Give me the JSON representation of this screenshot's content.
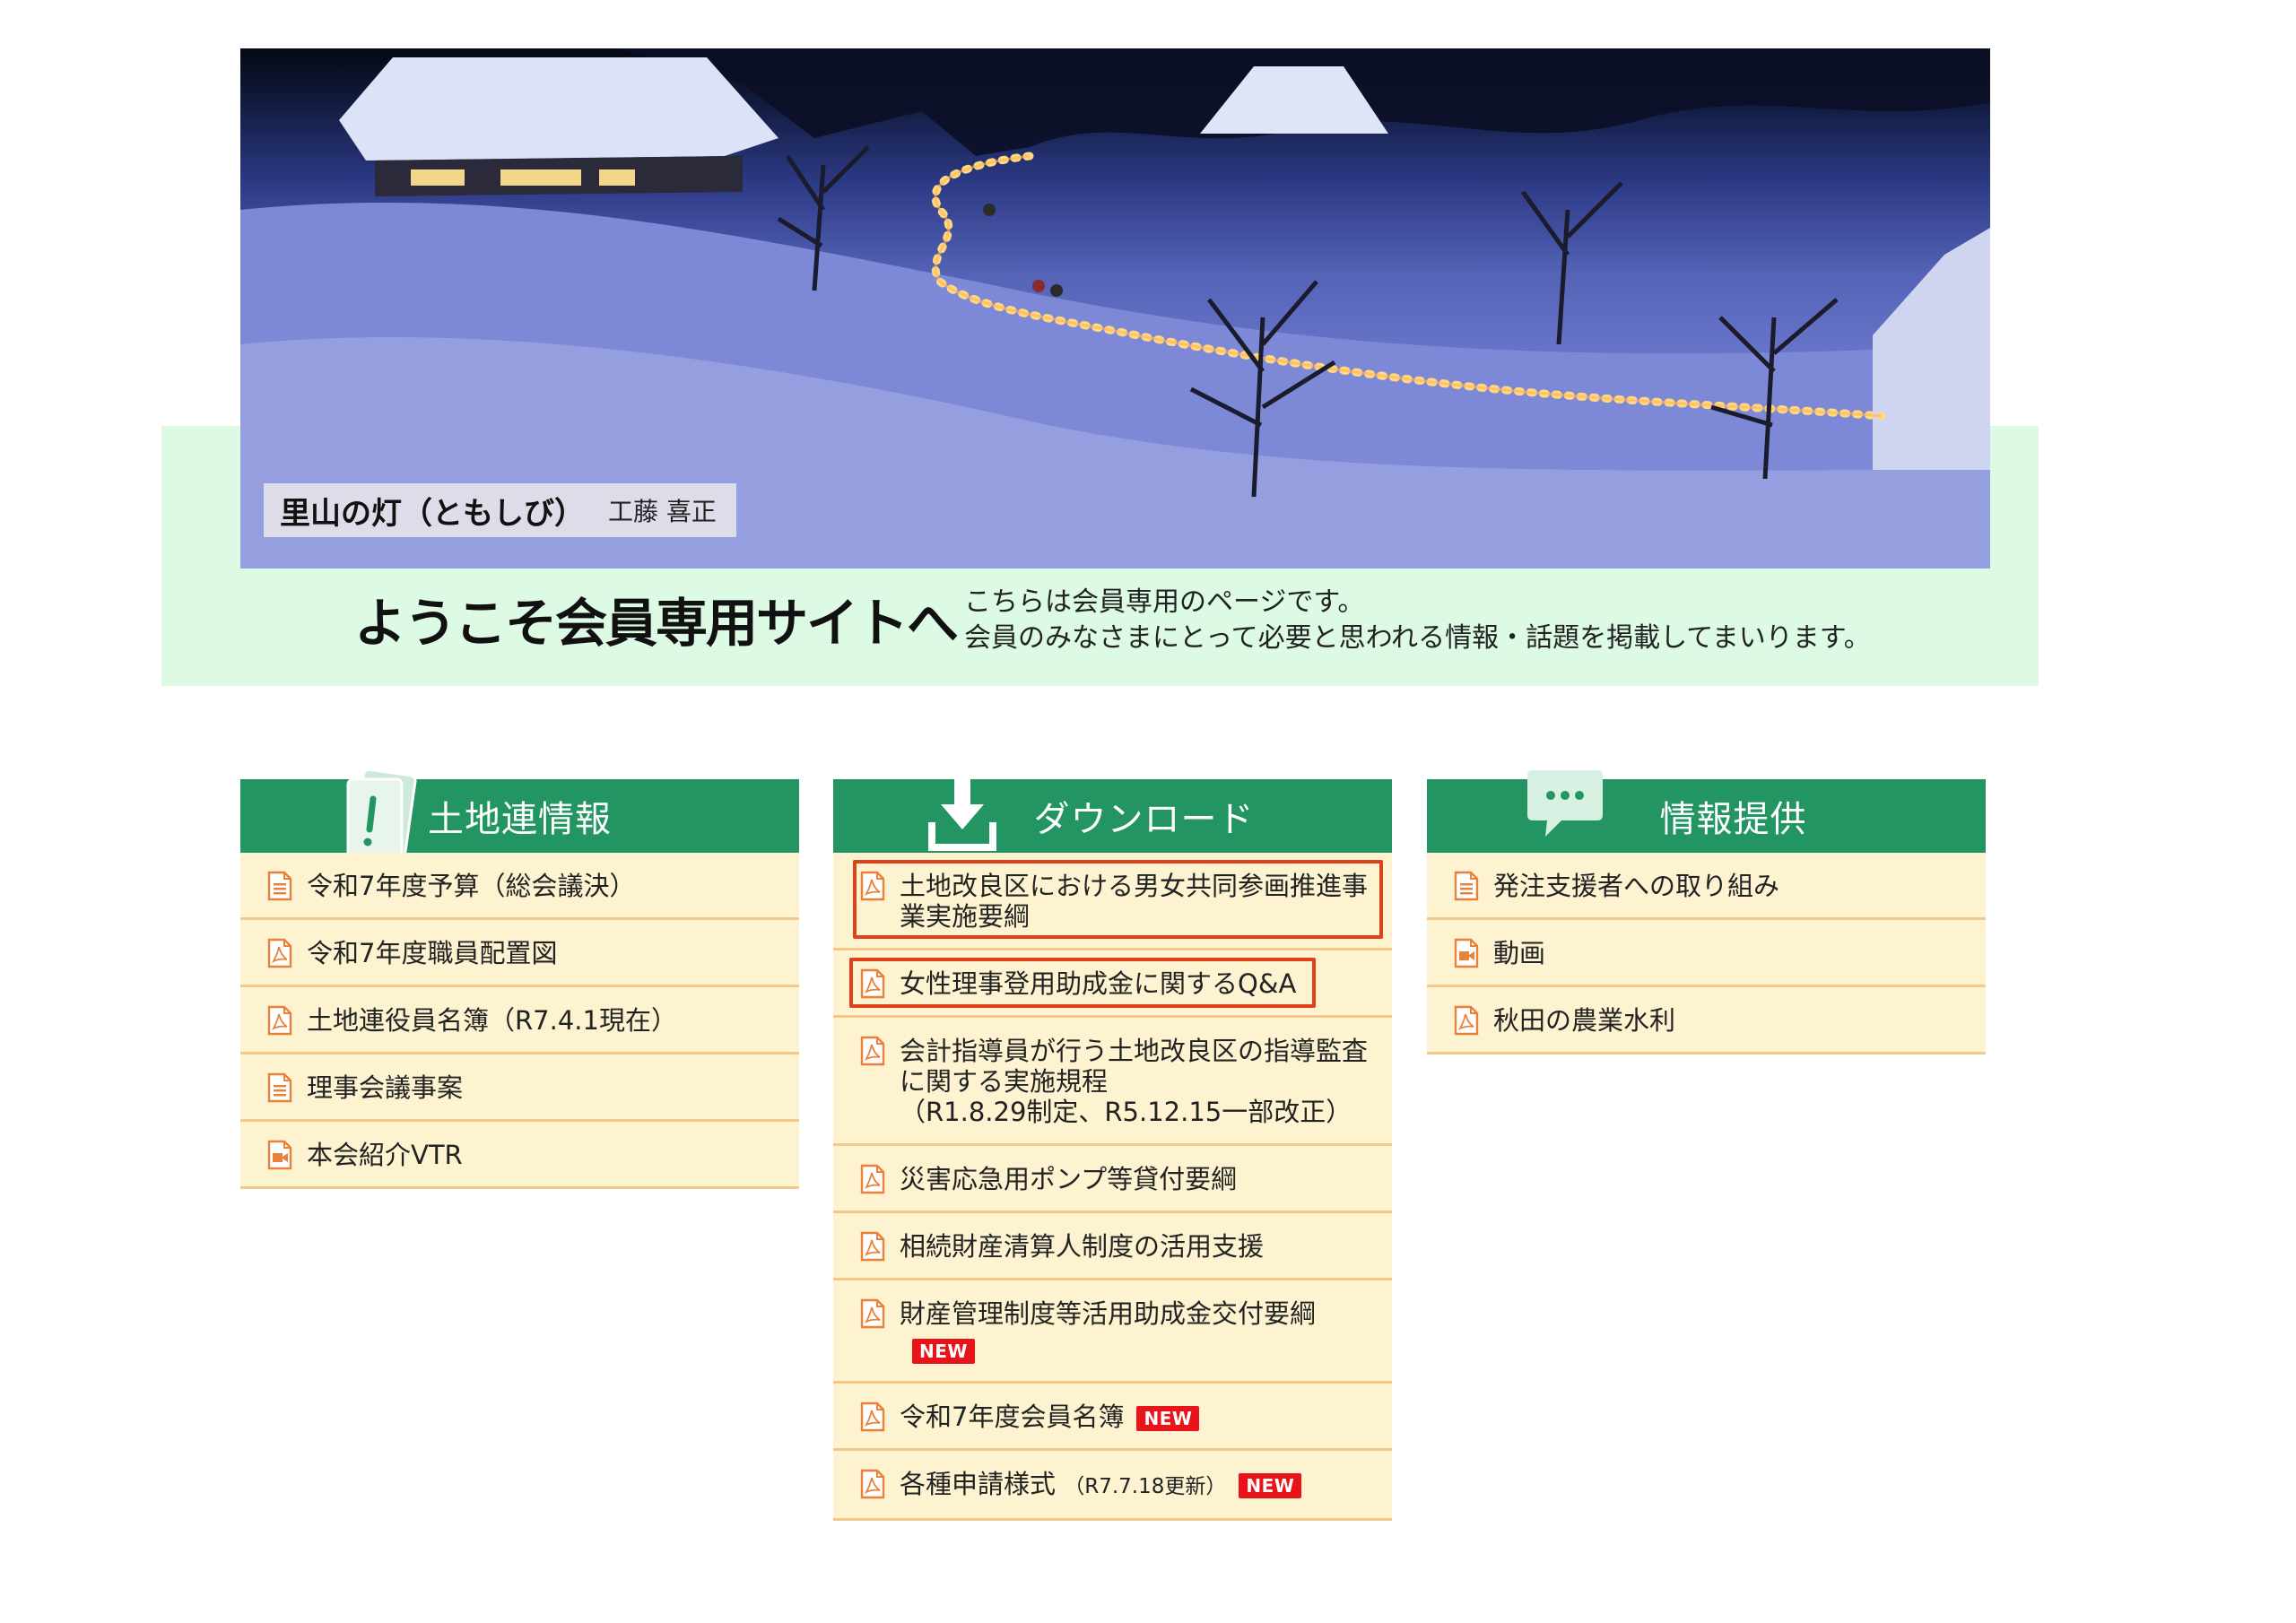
{
  "hero": {
    "caption_title": "里山の灯（ともしび）",
    "caption_author": "工藤 喜正",
    "welcome_title": "ようこそ会員専用サイトへ",
    "welcome_line1": "こちらは会員専用のページです。",
    "welcome_line2": "会員のみなさまにとって必要と思われる情報・話題を掲載してまいります。"
  },
  "panels": {
    "info": {
      "title": "土地連情報",
      "icon": "document-exclamation-icon",
      "items": [
        {
          "label": "令和7年度予算（総会議決）",
          "icon": "document-icon"
        },
        {
          "label": "令和7年度職員配置図",
          "icon": "pdf-icon"
        },
        {
          "label": "土地連役員名簿（R7.4.1現在）",
          "icon": "pdf-icon"
        },
        {
          "label": "理事会議事案",
          "icon": "document-icon"
        },
        {
          "label": "本会紹介VTR",
          "icon": "video-icon"
        }
      ]
    },
    "download": {
      "title": "ダウンロード",
      "icon": "download-icon",
      "items": [
        {
          "line1": "土地改良区における男女共同参画推進事",
          "line2": "業実施要綱",
          "icon": "pdf-icon"
        },
        {
          "label": "女性理事登用助成金に関するQ&A",
          "icon": "pdf-icon"
        },
        {
          "line1": "会計指導員が行う土地改良区の指導監査",
          "line2": "に関する実施規程",
          "line3": "（R1.8.29制定、R5.12.15一部改正）",
          "icon": "pdf-icon"
        },
        {
          "label": "災害応急用ポンプ等貸付要綱",
          "icon": "pdf-icon"
        },
        {
          "label": "相続財産清算人制度の活用支援",
          "icon": "pdf-icon"
        },
        {
          "label": "財産管理制度等活用助成金交付要綱",
          "badge": "NEW",
          "icon": "pdf-icon"
        },
        {
          "label": "令和7年度会員名簿",
          "badge": "NEW",
          "icon": "pdf-icon"
        },
        {
          "label": "各種申請様式",
          "note": "（R7.7.18更新）",
          "badge": "NEW",
          "icon": "pdf-icon"
        }
      ]
    },
    "provide": {
      "title": "情報提供",
      "icon": "speech-bubble-icon",
      "items": [
        {
          "label": "発注支援者への取り組み",
          "icon": "document-icon"
        },
        {
          "label": "動画",
          "icon": "video-icon"
        },
        {
          "label": "秋田の農業水利",
          "icon": "pdf-icon"
        }
      ]
    }
  },
  "colors": {
    "panel_header": "#239562",
    "item_background": "#fdf3d0",
    "item_border": "#f4c88a",
    "welcome_band": "#ddfbe4",
    "highlight_border": "#e0401a",
    "new_badge": "#e8141a",
    "file_icon": "#e8823a"
  }
}
